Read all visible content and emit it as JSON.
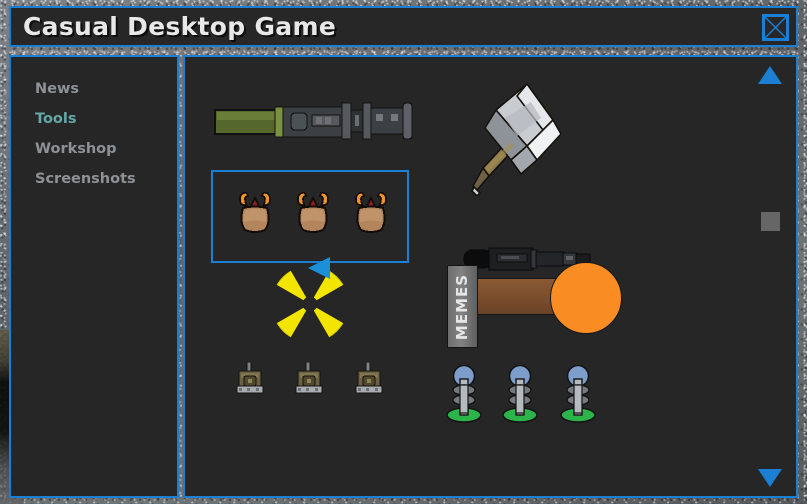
{
  "window": {
    "title": "Casual Desktop Game",
    "close_icon": "close-x-icon",
    "accent_color": "#1b7fd4",
    "panel_color": "#262626",
    "titlebar_color": "#272727"
  },
  "sidebar": {
    "items": [
      {
        "label": "News",
        "selected": false
      },
      {
        "label": "Tools",
        "selected": true
      },
      {
        "label": "Workshop",
        "selected": false
      },
      {
        "label": "Screenshots",
        "selected": false
      }
    ],
    "selected_color": "#63a8a6",
    "item_color": "#8e9195"
  },
  "main": {
    "scrollbar": {
      "up_arrow_icon": "triangle-up-icon",
      "down_arrow_icon": "triangle-down-icon",
      "thumb_icon": "scroll-thumb",
      "thumb_color": "#666666",
      "arrow_color": "#1b7fd4"
    },
    "cursor": {
      "icon": "cursor-arrow-icon",
      "color": "#1b8fd8"
    },
    "selection": {
      "icon": "selection-box",
      "border_color": "#1b7fd4",
      "selected_count": 3
    },
    "sign": {
      "text": "MEMES",
      "sign_color": "#7a7a7a",
      "bar_color": "#7a4d2c",
      "ball_color": "#fa8c24"
    },
    "items": [
      {
        "name": "green-barrel-tool",
        "icon": "telescope-icon",
        "color": "#5f6f33"
      },
      {
        "name": "sledgehammer",
        "icon": "hammer-icon",
        "color": "#b9bcc2"
      },
      {
        "name": "black-baton-tool",
        "icon": "baton-icon",
        "color": "#1c1c1c"
      },
      {
        "name": "crab-unit-1",
        "icon": "crab-icon",
        "color": "#b3855c"
      },
      {
        "name": "crab-unit-2",
        "icon": "crab-icon",
        "color": "#b3855c"
      },
      {
        "name": "crab-unit-3",
        "icon": "crab-icon",
        "color": "#b3855c"
      },
      {
        "name": "radiation-symbol",
        "icon": "radiation-icon",
        "color": "#f2e500"
      },
      {
        "name": "tank-unit-1",
        "icon": "tank-icon",
        "color": "#6a6144"
      },
      {
        "name": "tank-unit-2",
        "icon": "tank-icon",
        "color": "#6a6144"
      },
      {
        "name": "tank-unit-3",
        "icon": "tank-icon",
        "color": "#6a6144"
      },
      {
        "name": "antenna-unit-1",
        "icon": "antenna-icon",
        "color": "#7d9ecb"
      },
      {
        "name": "antenna-unit-2",
        "icon": "antenna-icon",
        "color": "#7d9ecb"
      },
      {
        "name": "antenna-unit-3",
        "icon": "antenna-icon",
        "color": "#7d9ecb"
      }
    ]
  }
}
